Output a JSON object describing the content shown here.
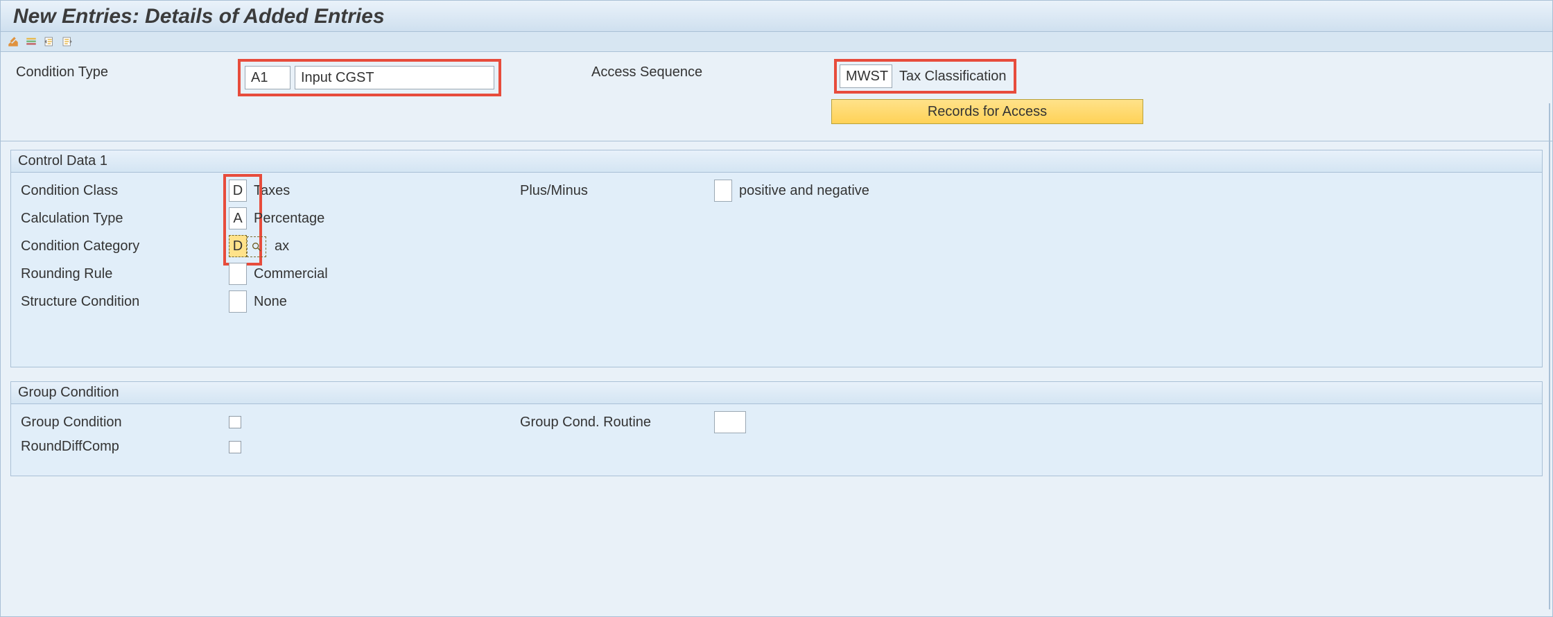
{
  "title": "New Entries: Details of Added Entries",
  "toolbar": {
    "icons": [
      "toggle-edit-icon",
      "delimit-icon",
      "previous-entry-icon",
      "next-entry-icon"
    ]
  },
  "header": {
    "condition_type_label": "Condition Type",
    "condition_type_code": "A1",
    "condition_type_desc": "Input CGST",
    "access_sequence_label": "Access Sequence",
    "access_sequence_code": "MWST",
    "access_sequence_desc": "Tax Classification",
    "records_button": "Records for Access"
  },
  "control_data_1": {
    "title": "Control Data 1",
    "condition_class_label": "Condition Class",
    "condition_class_code": "D",
    "condition_class_desc": "Taxes",
    "calculation_type_label": "Calculation Type",
    "calculation_type_code": "A",
    "calculation_type_desc": "Percentage",
    "condition_category_label": "Condition Category",
    "condition_category_code": "D",
    "condition_category_desc_suffix": "ax",
    "rounding_rule_label": "Rounding Rule",
    "rounding_rule_code": "",
    "rounding_rule_desc": "Commercial",
    "structure_condition_label": "Structure Condition",
    "structure_condition_code": "",
    "structure_condition_desc": "None",
    "plus_minus_label": "Plus/Minus",
    "plus_minus_code": "",
    "plus_minus_desc": "positive and negative"
  },
  "group_condition": {
    "title": "Group Condition",
    "group_condition_label": "Group Condition",
    "round_diff_comp_label": "RoundDiffComp",
    "group_cond_routine_label": "Group Cond. Routine",
    "group_cond_routine_value": ""
  }
}
